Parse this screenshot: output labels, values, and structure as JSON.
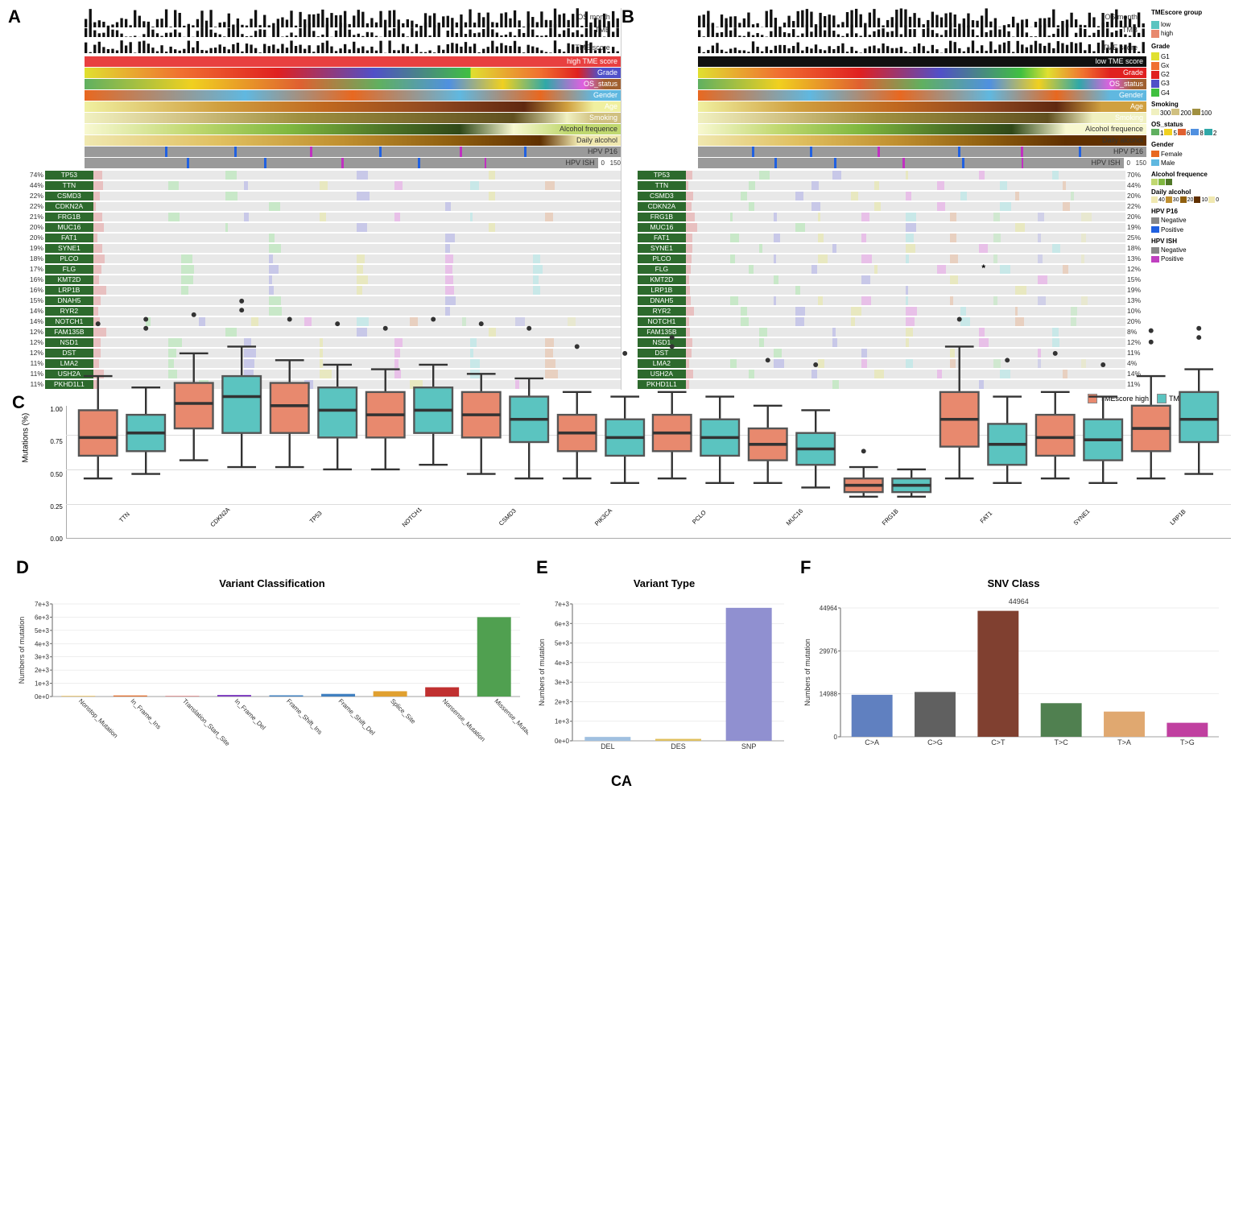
{
  "panels": {
    "a_label": "A",
    "b_label": "B",
    "c_label": "C",
    "d_label": "D",
    "e_label": "E",
    "f_label": "F"
  },
  "panelA": {
    "tracks": [
      {
        "label": "OS month",
        "type": "barplot",
        "color": "#111"
      },
      {
        "label": "TMB",
        "type": "barplot",
        "color": "#111"
      },
      {
        "label": "TME score",
        "type": "barplot",
        "color": "#111"
      },
      {
        "label": "high TME score",
        "type": "heatmap",
        "color": "#e63"
      },
      {
        "label": "Grade",
        "type": "heatmap",
        "colors": [
          "#e6e620",
          "#f07030",
          "#e62020",
          "#5050c8",
          "#40c040"
        ]
      },
      {
        "label": "OS_status",
        "type": "heatmap",
        "colors": [
          "#60b060",
          "#f0d020",
          "#e06030",
          "#5090e0",
          "#30a8a8",
          "#e060e0",
          "#a06030"
        ]
      },
      {
        "label": "Gender",
        "type": "heatmap",
        "colors": [
          "#e86820",
          "#60b8e0"
        ]
      },
      {
        "label": "Age",
        "type": "heatmap",
        "colors": [
          "#f0f0a0",
          "#d0a040",
          "#c06820",
          "#904820",
          "#602810"
        ]
      },
      {
        "label": "Smoking",
        "type": "heatmap",
        "colors": [
          "#f0f0a0",
          "#d0c080",
          "#a09040",
          "#807030",
          "#605020"
        ]
      },
      {
        "label": "Alcohol frequence",
        "type": "heatmap",
        "colors": [
          "#f0f0e0",
          "#d0e0a0",
          "#90c060",
          "#508030",
          "#305018",
          "#18300a"
        ]
      },
      {
        "label": "Daily alcohol",
        "type": "heatmap",
        "colors": [
          "#f0e8c0",
          "#e0c070",
          "#c09030",
          "#906010",
          "#603000"
        ]
      },
      {
        "label": "HPV P16",
        "type": "heatmap",
        "colors": [
          "#888",
          "#2060e0",
          "#c030c0"
        ]
      },
      {
        "label": "HPV ISH",
        "type": "heatmap",
        "colors": [
          "#888",
          "#2060e0",
          "#c030c0"
        ]
      }
    ],
    "genes": [
      {
        "name": "TP53",
        "pct_left": "74%",
        "pct_right": "70%"
      },
      {
        "name": "TTN",
        "pct_left": "44%",
        "pct_right": "44%"
      },
      {
        "name": "CSMD3",
        "pct_left": "22%",
        "pct_right": "20%"
      },
      {
        "name": "CDKN2A",
        "pct_left": "22%",
        "pct_right": "22%"
      },
      {
        "name": "FRG1B",
        "pct_left": "21%",
        "pct_right": "20%"
      },
      {
        "name": "MUC16",
        "pct_left": "20%",
        "pct_right": "19%"
      },
      {
        "name": "FAT1",
        "pct_left": "20%",
        "pct_right": "25%"
      },
      {
        "name": "SYNE1",
        "pct_left": "19%",
        "pct_right": "18%"
      },
      {
        "name": "PLCO",
        "pct_left": "18%",
        "pct_right": "13%"
      },
      {
        "name": "FLG",
        "pct_left": "17%",
        "pct_right": "12%"
      },
      {
        "name": "KMT2D",
        "pct_left": "16%",
        "pct_right": "15%"
      },
      {
        "name": "LRP1B",
        "pct_left": "16%",
        "pct_right": "19%"
      },
      {
        "name": "DNAH5",
        "pct_left": "15%",
        "pct_right": "13%"
      },
      {
        "name": "RYR2",
        "pct_left": "14%",
        "pct_right": "10%"
      },
      {
        "name": "NOTCH1",
        "pct_left": "14%",
        "pct_right": "20%"
      },
      {
        "name": "FAM135B",
        "pct_left": "12%",
        "pct_right": "8%"
      },
      {
        "name": "NSD1",
        "pct_left": "12%",
        "pct_right": "12%"
      },
      {
        "name": "DST",
        "pct_left": "12%",
        "pct_right": "11%"
      },
      {
        "name": "LMA2",
        "pct_left": "11%",
        "pct_right": "4%"
      },
      {
        "name": "USH2A",
        "pct_left": "11%",
        "pct_right": "14%"
      },
      {
        "name": "PKHD1L1",
        "pct_left": "11%",
        "pct_right": "11%"
      }
    ]
  },
  "panelC": {
    "y_label": "Mutations (%)",
    "y_ticks": [
      "0.00",
      "0.25",
      "0.50",
      "0.75",
      "1.00"
    ],
    "legend": [
      "TMEscore high",
      "TMEscore low"
    ],
    "genes": [
      "TTN",
      "CDKN2A",
      "TP53",
      "NOTCH1",
      "CSMD3",
      "PIK3CA",
      "PCLO",
      "MUC16",
      "FRG1B",
      "FAT1",
      "SYNE1",
      "LRP1B"
    ],
    "asterisk_gene": "FAT1",
    "colors": {
      "high": "#e8896e",
      "low": "#5bc4c0"
    }
  },
  "panelD": {
    "title": "Variant Classification",
    "y_label": "Numbers of mutation",
    "y_ticks": [
      "0e+0",
      "1e+3",
      "2e+3",
      "3e+3",
      "4e+3",
      "5e+3",
      "6e+3",
      "7e+3"
    ],
    "bars": [
      {
        "label": "Nonstop_Mutation",
        "value": 50,
        "color": "#e8c060"
      },
      {
        "label": "In_Frame_Ins",
        "value": 80,
        "color": "#e07030"
      },
      {
        "label": "Translation_Start_Site",
        "value": 30,
        "color": "#c03030"
      },
      {
        "label": "In_Frame_Del",
        "value": 120,
        "color": "#8040c0"
      },
      {
        "label": "Frame_Shift_Ins",
        "value": 90,
        "color": "#4080c0"
      },
      {
        "label": "Frame_Shift_Del",
        "value": 200,
        "color": "#4080c0"
      },
      {
        "label": "Splice_Site",
        "value": 400,
        "color": "#e0a030"
      },
      {
        "label": "Nonsense_Mutation",
        "value": 700,
        "color": "#c03030"
      },
      {
        "label": "Missense_Mutation",
        "value": 6000,
        "color": "#50a050"
      }
    ],
    "max_value": 7000
  },
  "panelE": {
    "title": "Variant Type",
    "y_label": "Numbers of mutation",
    "y_ticks": [
      "0e+0",
      "1e+3",
      "2e+3",
      "3e+3",
      "4e+3",
      "5e+3",
      "6e+3",
      "7e+3"
    ],
    "bars": [
      {
        "label": "DEL",
        "value": 200,
        "color": "#a0c0e0"
      },
      {
        "label": "DES",
        "value": 100,
        "color": "#e0c060"
      },
      {
        "label": "SNP",
        "value": 6800,
        "color": "#9090d0"
      }
    ],
    "max_value": 7000
  },
  "panelF": {
    "title": "SNV Class",
    "y_label": "Numbers of mutation",
    "y_ticks": [
      "0",
      "14988",
      "29976",
      "44964"
    ],
    "top_value": "44964",
    "bars": [
      {
        "label": "C>A",
        "value": 14988,
        "color": "#6080c0"
      },
      {
        "label": "C>G",
        "value": 16000,
        "color": "#606060"
      },
      {
        "label": "C>T",
        "value": 44964,
        "color": "#804030"
      },
      {
        "label": "T>C",
        "value": 12000,
        "color": "#508050"
      },
      {
        "label": "T>A",
        "value": 9000,
        "color": "#e0a870"
      },
      {
        "label": "T>G",
        "value": 5000,
        "color": "#c040a0"
      }
    ],
    "max_value": 46000
  }
}
